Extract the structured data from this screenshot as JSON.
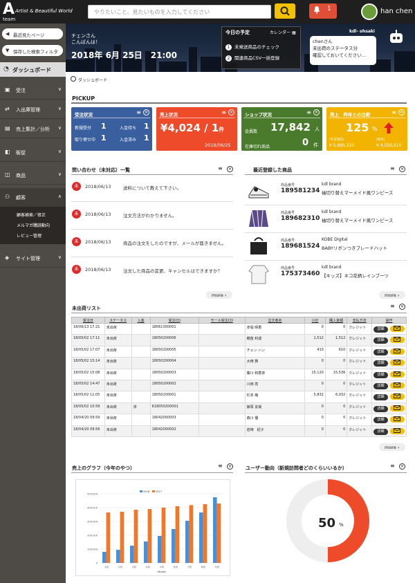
{
  "header": {
    "logo": "A",
    "logo_sub": "team",
    "tagline": "Artist & Beautiful World",
    "search_placeholder": "やりたいこと、見たいものを入力してください",
    "notifications": "1",
    "username": "han chen"
  },
  "sidebar": {
    "recent": "最近見たページ",
    "saved_filter": "保存した検索フィルタ",
    "dashboard": "ダッシュボード",
    "items": [
      {
        "label": "受注"
      },
      {
        "label": "入出庫管理"
      },
      {
        "label": "売上集計／分析"
      },
      {
        "label": "販促"
      },
      {
        "label": "商品"
      },
      {
        "label": "顧客"
      }
    ],
    "customer_sub": [
      "顧客検索／修正",
      "メルマガ購読動向",
      "レビュー管理"
    ],
    "site": "サイト管理"
  },
  "banner": {
    "greet1": "チェンさん",
    "greet2": "こんばんは！",
    "datetime": "2018年 6月 25日　21:00",
    "schedule_title": "今日の予定",
    "calendar": "カレンダー",
    "schedule": [
      {
        "n": "1",
        "text": "未発送商品のチェック"
      },
      {
        "n": "2",
        "text": "関連商品CSV一括登録"
      }
    ],
    "bot_name": "kdl- ohsaki",
    "message": [
      "chenさん",
      "未出荷のステータス分",
      "確認しておいてください…"
    ]
  },
  "breadcrumb": "ダッシュボード",
  "pickup": {
    "title": "PICKUP",
    "order": {
      "title": "受注状況",
      "new_label": "新規受付",
      "new": "1",
      "wait_label": "入金待ち",
      "wait": "1",
      "pick_label": "取り寄せ中",
      "pick": "1",
      "paid_label": "入金済み",
      "paid": "1",
      "color": "#3a5f9e"
    },
    "sales": {
      "title": "売上状況",
      "amount": "¥4,024",
      "count": "/ 1",
      "unit": "件",
      "date": "2018/06/25",
      "color": "#ee4b2b"
    },
    "shop": {
      "title": "ショップ状況",
      "members_label": "会員数",
      "members": "17,842",
      "members_unit": "人",
      "stock_label": "在庫切れ商品",
      "stock": "0",
      "stock_unit": "件",
      "color": "#4a7a2c"
    },
    "yoy": {
      "title": "売上　昨年との比較",
      "percent": "125",
      "percent_unit": "%",
      "this_label": "(今日現在)",
      "this": "¥ 5,695,320",
      "last_label": "(昨年)",
      "last": "¥ 4,550,910",
      "color": "#f2b400"
    }
  },
  "inquiries": {
    "title": "問い合わせ（未対応）一覧",
    "badge": "未",
    "more": "more",
    "rows": [
      {
        "date": "2018/06/13",
        "text": "送料について教えて下さい。"
      },
      {
        "date": "2018/06/13",
        "text": "注文方法がわかりません。"
      },
      {
        "date": "2018/06/13",
        "text": "商品の注文をしたのですが、メールが届きません。"
      },
      {
        "date": "2018/06/13",
        "text": "注文した商品の変更、キャンセルはできますか？"
      }
    ]
  },
  "products": {
    "title": "最近登録した商品",
    "code_label": "商品番号",
    "more": "more",
    "rows": [
      {
        "code": "189581234",
        "brand": "kdl brand",
        "name": "袖切り替えマーメイド風ワンピース"
      },
      {
        "code": "189682310",
        "brand": "kdl brand",
        "name": "袖切り替えマーメイド風ワンピース"
      },
      {
        "code": "189681524",
        "brand": "KOBE Digital",
        "name": "BABYリボンつきブレードハット"
      },
      {
        "code": "175373460",
        "brand": "kdl brand",
        "name": "【キッズ】ネコ花柄レインブーツ"
      }
    ]
  },
  "shipments": {
    "title": "未出荷リスト",
    "more": "more",
    "detail_label": "詳細",
    "headers": [
      "受注日",
      "ステータス",
      "入金",
      "受注CD",
      "モール受注CD",
      "注文者名",
      "小計",
      "購入金額",
      "支払方法",
      "操作"
    ],
    "rows": [
      [
        "18/06/13 17:21",
        "未出荷",
        "",
        "18061300001",
        "",
        "赤堀 晴香",
        "0",
        "0",
        "クレジット"
      ],
      [
        "18/05/02 17:11",
        "未出荷",
        "",
        "18050200006",
        "",
        "穂苗 利成",
        "1,512",
        "1,512",
        "クレジット"
      ],
      [
        "18/05/02 17:07",
        "未出荷",
        "",
        "18050200005",
        "",
        "チェン ハン",
        "410",
        "610",
        "クレジット"
      ],
      [
        "18/05/02 15:14",
        "未出荷",
        "",
        "18050200004",
        "",
        "大崎 賢",
        "0",
        "0",
        "クレジット"
      ],
      [
        "18/05/02 15:08",
        "未出荷",
        "",
        "18050200003",
        "",
        "藤川 和香奈",
        "15,120",
        "15,536",
        "クレジット"
      ],
      [
        "18/05/02 14:47",
        "未出荷",
        "",
        "18050200002",
        "",
        "川田 亮",
        "0",
        "0",
        "クレジット"
      ],
      [
        "18/05/02 11:05",
        "未出荷",
        "",
        "18050200001",
        "",
        "杉本 萌",
        "5,832",
        "6,032",
        "クレジット"
      ],
      [
        "18/05/02 10:59",
        "未出荷",
        "済",
        "K18050200001",
        "",
        "飯塚 友哉",
        "0",
        "0",
        "クレジット"
      ],
      [
        "18/04/20 09:59",
        "未出荷",
        "",
        "18042000003",
        "",
        "森川 優",
        "0",
        "0",
        "クレジット"
      ],
      [
        "18/04/20 09:56",
        "未出荷",
        "",
        "18042000002",
        "",
        "岩崎　紀子",
        "0",
        "0",
        "クレジット"
      ]
    ]
  },
  "sales_chart": {
    "title": "売上のグラフ（今年のやつ）"
  },
  "chart_data": {
    "type": "bar",
    "categories": [
      "1月",
      "2月",
      "3月",
      "4月",
      "5月",
      "6月",
      "7月",
      "8月",
      "9月"
    ],
    "series": [
      {
        "name": "2018",
        "color": "#4a90d9",
        "values": [
          80000,
          95000,
          125000,
          155000,
          195000,
          245000,
          305000,
          365000,
          475000
        ]
      },
      {
        "name": "2017",
        "color": "#f0782d",
        "values": [
          365000,
          370000,
          385000,
          390000,
          400000,
          410000,
          418000,
          425000,
          430000
        ]
      }
    ],
    "xlabel": "Month",
    "ylabel": "",
    "ylim": [
      0,
      500000
    ],
    "yticks": [
      "0",
      "100,000",
      "200,000",
      "300,000",
      "400,000",
      "500,000"
    ],
    "legend": "top"
  },
  "user_trend": {
    "title": "ユーザー動向（新規訪問者どのくらいいるか）",
    "percent": 50,
    "value": "50",
    "unit": "%",
    "color": "#ee4b2b",
    "track": "#eeeeee"
  }
}
